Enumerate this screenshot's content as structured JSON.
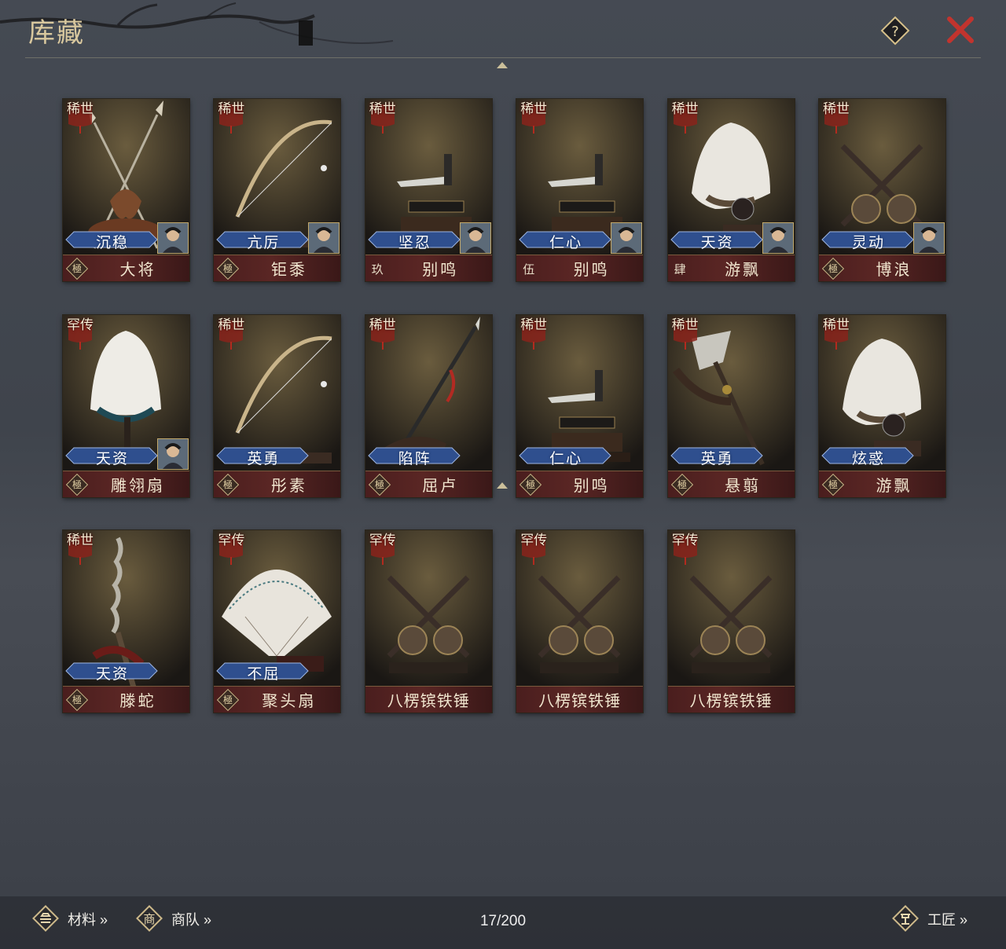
{
  "header": {
    "title": "库藏"
  },
  "footer": {
    "materials_label": "材料 »",
    "caravan_label": "商队 »",
    "craftsman_label": "工匠 »",
    "materials_icon": "ingot-icon",
    "caravan_icon": "merchant-icon",
    "craftsman_icon": "hammer-icon",
    "counter": "17/200"
  },
  "colors": {
    "plate": "#5a2624",
    "trait_badge": "#2f4f8e",
    "rarity_badge": "#8a231b"
  },
  "items": [
    {
      "name": "大将",
      "grade": "極",
      "rarity": "稀世",
      "trait": "沉稳",
      "portrait": true,
      "art": "crossed-spears"
    },
    {
      "name": "钜黍",
      "grade": "極",
      "rarity": "稀世",
      "trait": "亢厉",
      "portrait": true,
      "art": "bow"
    },
    {
      "name": "别鸣",
      "grade": "玖",
      "rarity": "稀世",
      "trait": "坚忍",
      "portrait": true,
      "art": "saber"
    },
    {
      "name": "别鸣",
      "grade": "伍",
      "rarity": "稀世",
      "trait": "仁心",
      "portrait": true,
      "art": "saber"
    },
    {
      "name": "游飘",
      "grade": "肆",
      "rarity": "稀世",
      "trait": "天资",
      "portrait": true,
      "art": "feather-fan"
    },
    {
      "name": "博浪",
      "grade": "極",
      "rarity": "稀世",
      "trait": "灵动",
      "portrait": true,
      "art": "crossed-hammers"
    },
    {
      "name": "雕翎扇",
      "grade": "極",
      "rarity": "罕传",
      "trait": "天资",
      "portrait": true,
      "art": "white-fan"
    },
    {
      "name": "彤素",
      "grade": "極",
      "rarity": "稀世",
      "trait": "英勇",
      "portrait": false,
      "art": "bow"
    },
    {
      "name": "屈卢",
      "grade": "極",
      "rarity": "稀世",
      "trait": "陷阵",
      "portrait": false,
      "art": "spear"
    },
    {
      "name": "别鸣",
      "grade": "極",
      "rarity": "稀世",
      "trait": "仁心",
      "portrait": false,
      "art": "saber"
    },
    {
      "name": "悬翦",
      "grade": "極",
      "rarity": "稀世",
      "trait": "英勇",
      "portrait": false,
      "art": "glaive"
    },
    {
      "name": "游飘",
      "grade": "極",
      "rarity": "稀世",
      "trait": "炫惑",
      "portrait": false,
      "art": "feather-fan"
    },
    {
      "name": "滕蛇",
      "grade": "極",
      "rarity": "稀世",
      "trait": "天资",
      "portrait": false,
      "art": "snake-spear"
    },
    {
      "name": "聚头扇",
      "grade": "極",
      "rarity": "罕传",
      "trait": "不屈",
      "portrait": false,
      "art": "folding-fan"
    },
    {
      "name": "八楞镔铁锤",
      "grade": "",
      "rarity": "罕传",
      "trait": "",
      "portrait": false,
      "art": "crossed-hammers"
    },
    {
      "name": "八楞镔铁锤",
      "grade": "",
      "rarity": "罕传",
      "trait": "",
      "portrait": false,
      "art": "crossed-hammers"
    },
    {
      "name": "八楞镔铁锤",
      "grade": "",
      "rarity": "罕传",
      "trait": "",
      "portrait": false,
      "art": "crossed-hammers"
    }
  ]
}
